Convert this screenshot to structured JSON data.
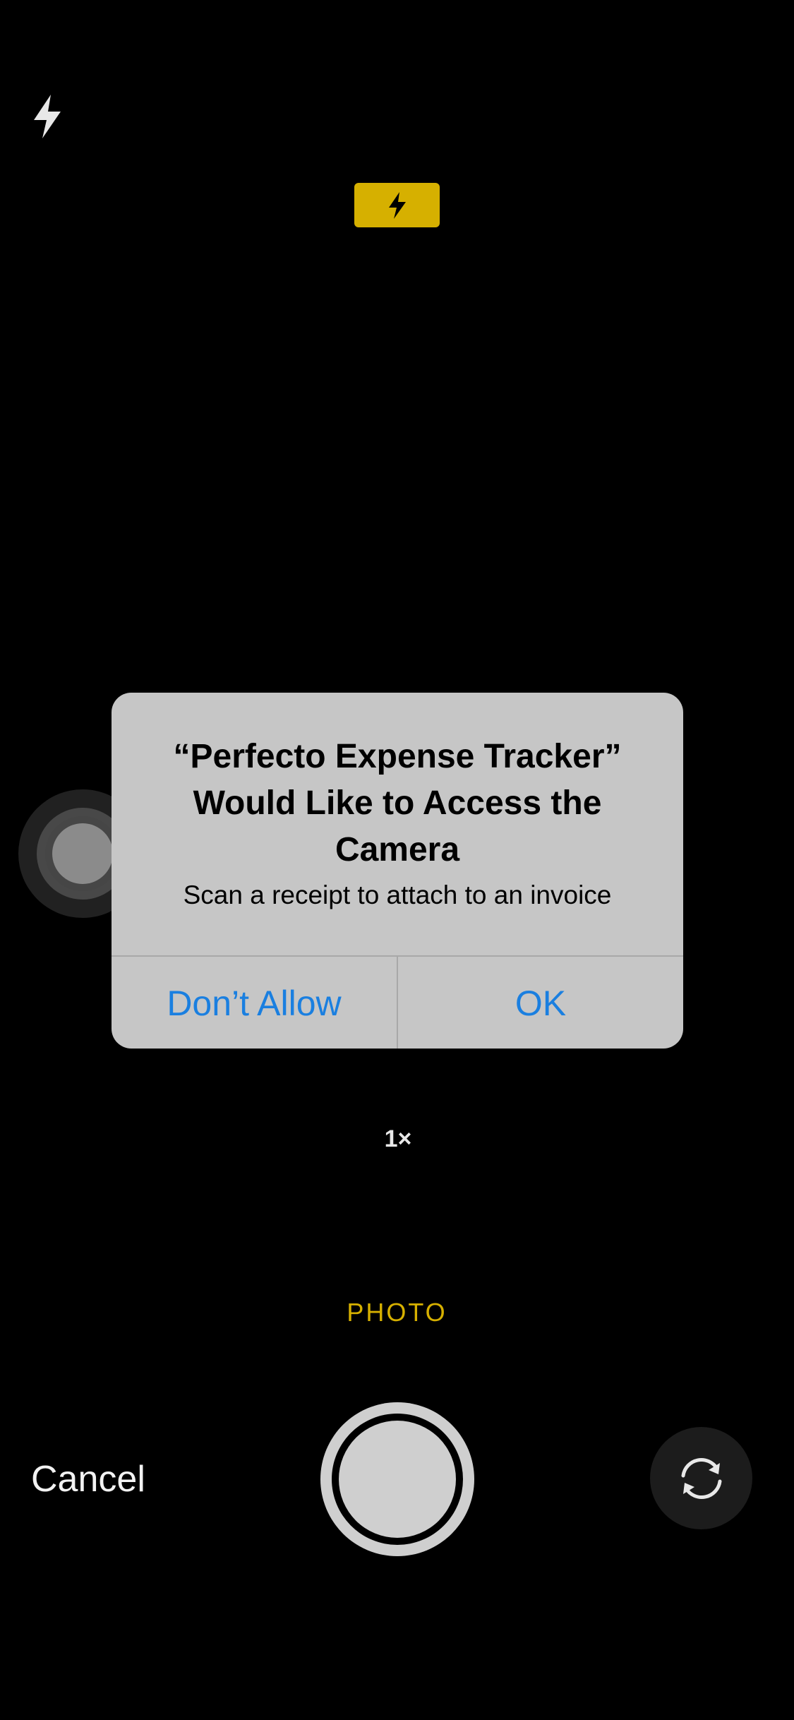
{
  "camera": {
    "flash_icon": "bolt-icon",
    "flash_indicator_icon": "bolt-icon",
    "flash_indicator_color": "#d6b000",
    "zoom_label": "1×",
    "mode_label": "PHOTO",
    "cancel_label": "Cancel",
    "flip_icon": "camera-flip-icon"
  },
  "alert": {
    "title": "“Perfecto Expense Tracker” Would Like to Access the Camera",
    "message": "Scan a receipt to attach to an invoice",
    "buttons": [
      {
        "label": "Don’t Allow"
      },
      {
        "label": "OK"
      }
    ],
    "button_color": "#1a7fe0"
  }
}
